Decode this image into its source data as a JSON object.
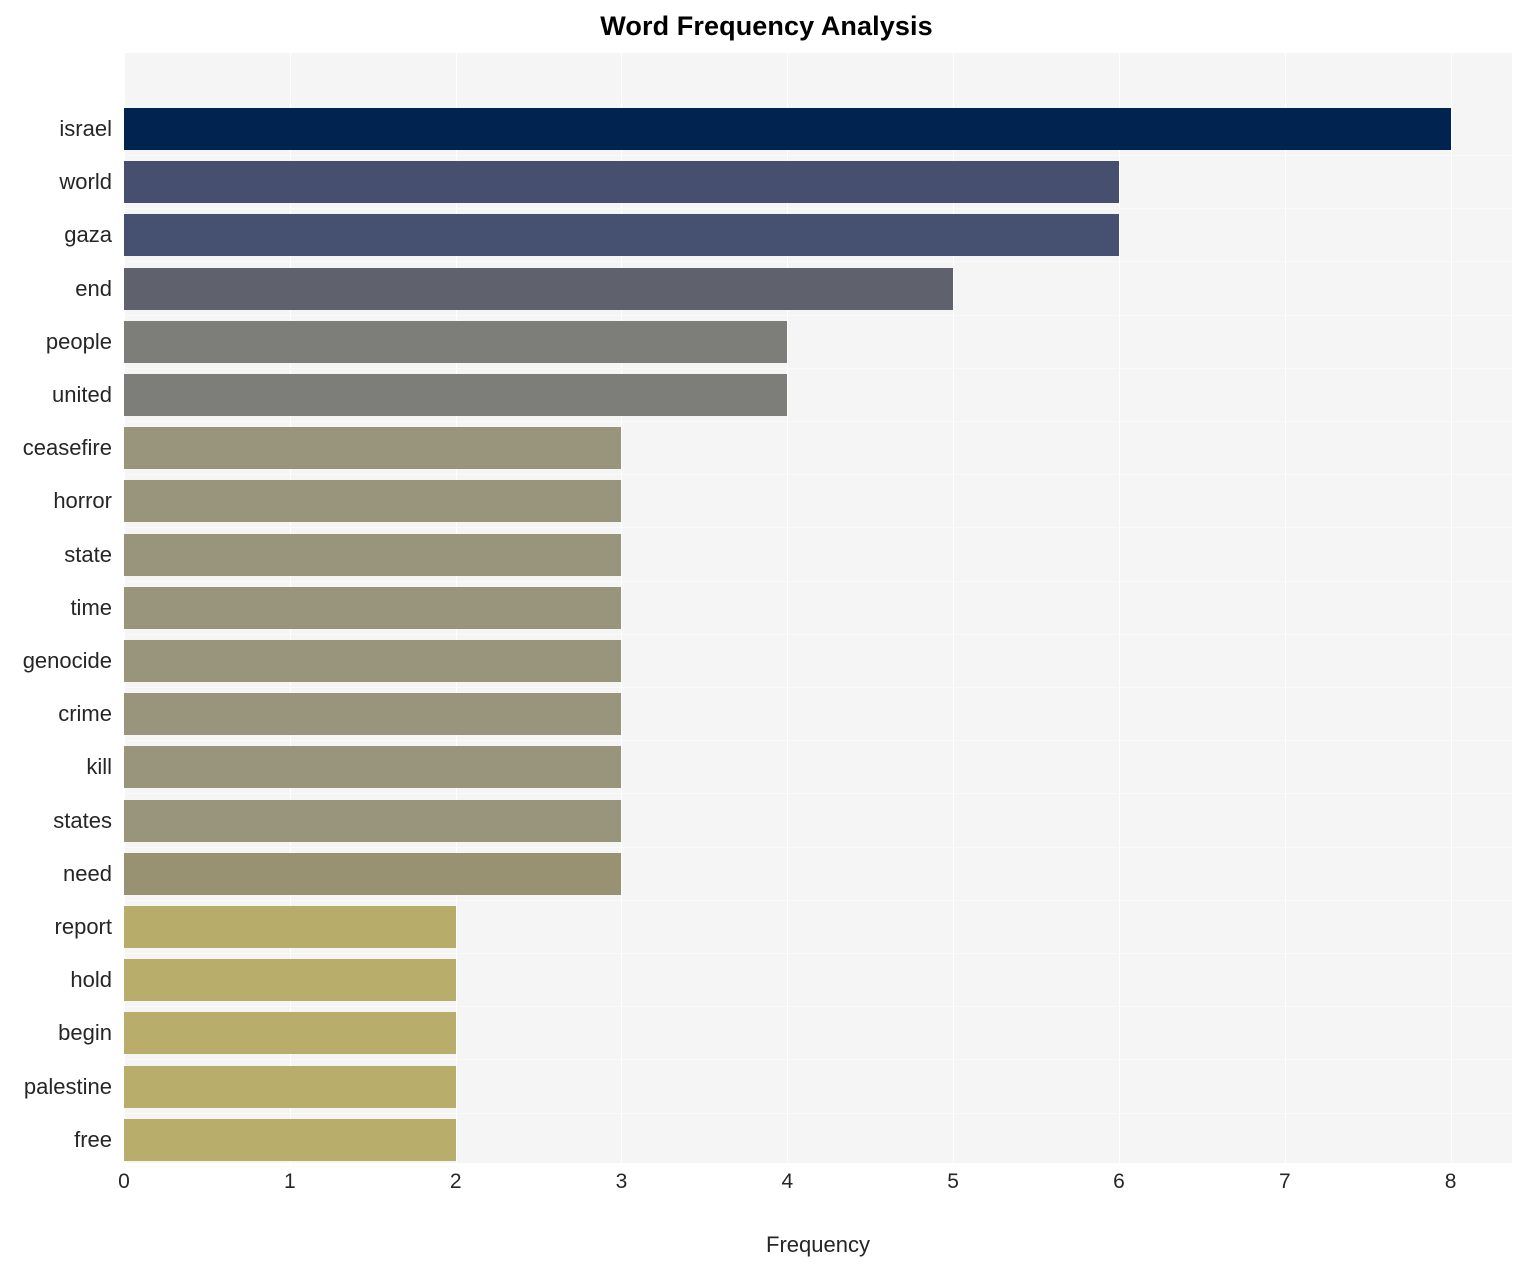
{
  "chart_data": {
    "type": "bar",
    "orientation": "horizontal",
    "title": "Word Frequency Analysis",
    "xlabel": "Frequency",
    "ylabel": "",
    "xlim": [
      0,
      8.37
    ],
    "xticks": [
      0,
      1,
      2,
      3,
      4,
      5,
      6,
      7,
      8
    ],
    "xtick_labels": [
      "0",
      "1",
      "2",
      "3",
      "4",
      "5",
      "6",
      "7",
      "8"
    ],
    "grid": true,
    "legend": "none",
    "categories": [
      "israel",
      "world",
      "gaza",
      "end",
      "people",
      "united",
      "ceasefire",
      "horror",
      "state",
      "time",
      "genocide",
      "crime",
      "kill",
      "states",
      "need",
      "report",
      "hold",
      "begin",
      "palestine",
      "free"
    ],
    "values": [
      8,
      6,
      6,
      5,
      4,
      4,
      3,
      3,
      3,
      3,
      3,
      3,
      3,
      3,
      3,
      2,
      2,
      2,
      2,
      2
    ],
    "bar_colors": [
      "#00234f",
      "#474f6e",
      "#465070",
      "#5f626c",
      "#7d7d7a",
      "#7d7d7a",
      "#99947c",
      "#99947c",
      "#99947c",
      "#99947c",
      "#99947c",
      "#99947c",
      "#99947c",
      "#99947c",
      "#989273",
      "#b8ac6b",
      "#b9ad6c",
      "#b9ad6c",
      "#b9ad6c",
      "#b9ad6c"
    ],
    "plot_background": "#f5f5f6",
    "figure_background": "#ffffff",
    "gridline_color": "#ffffff",
    "text_color": "#262626",
    "title_color": "#000000"
  }
}
